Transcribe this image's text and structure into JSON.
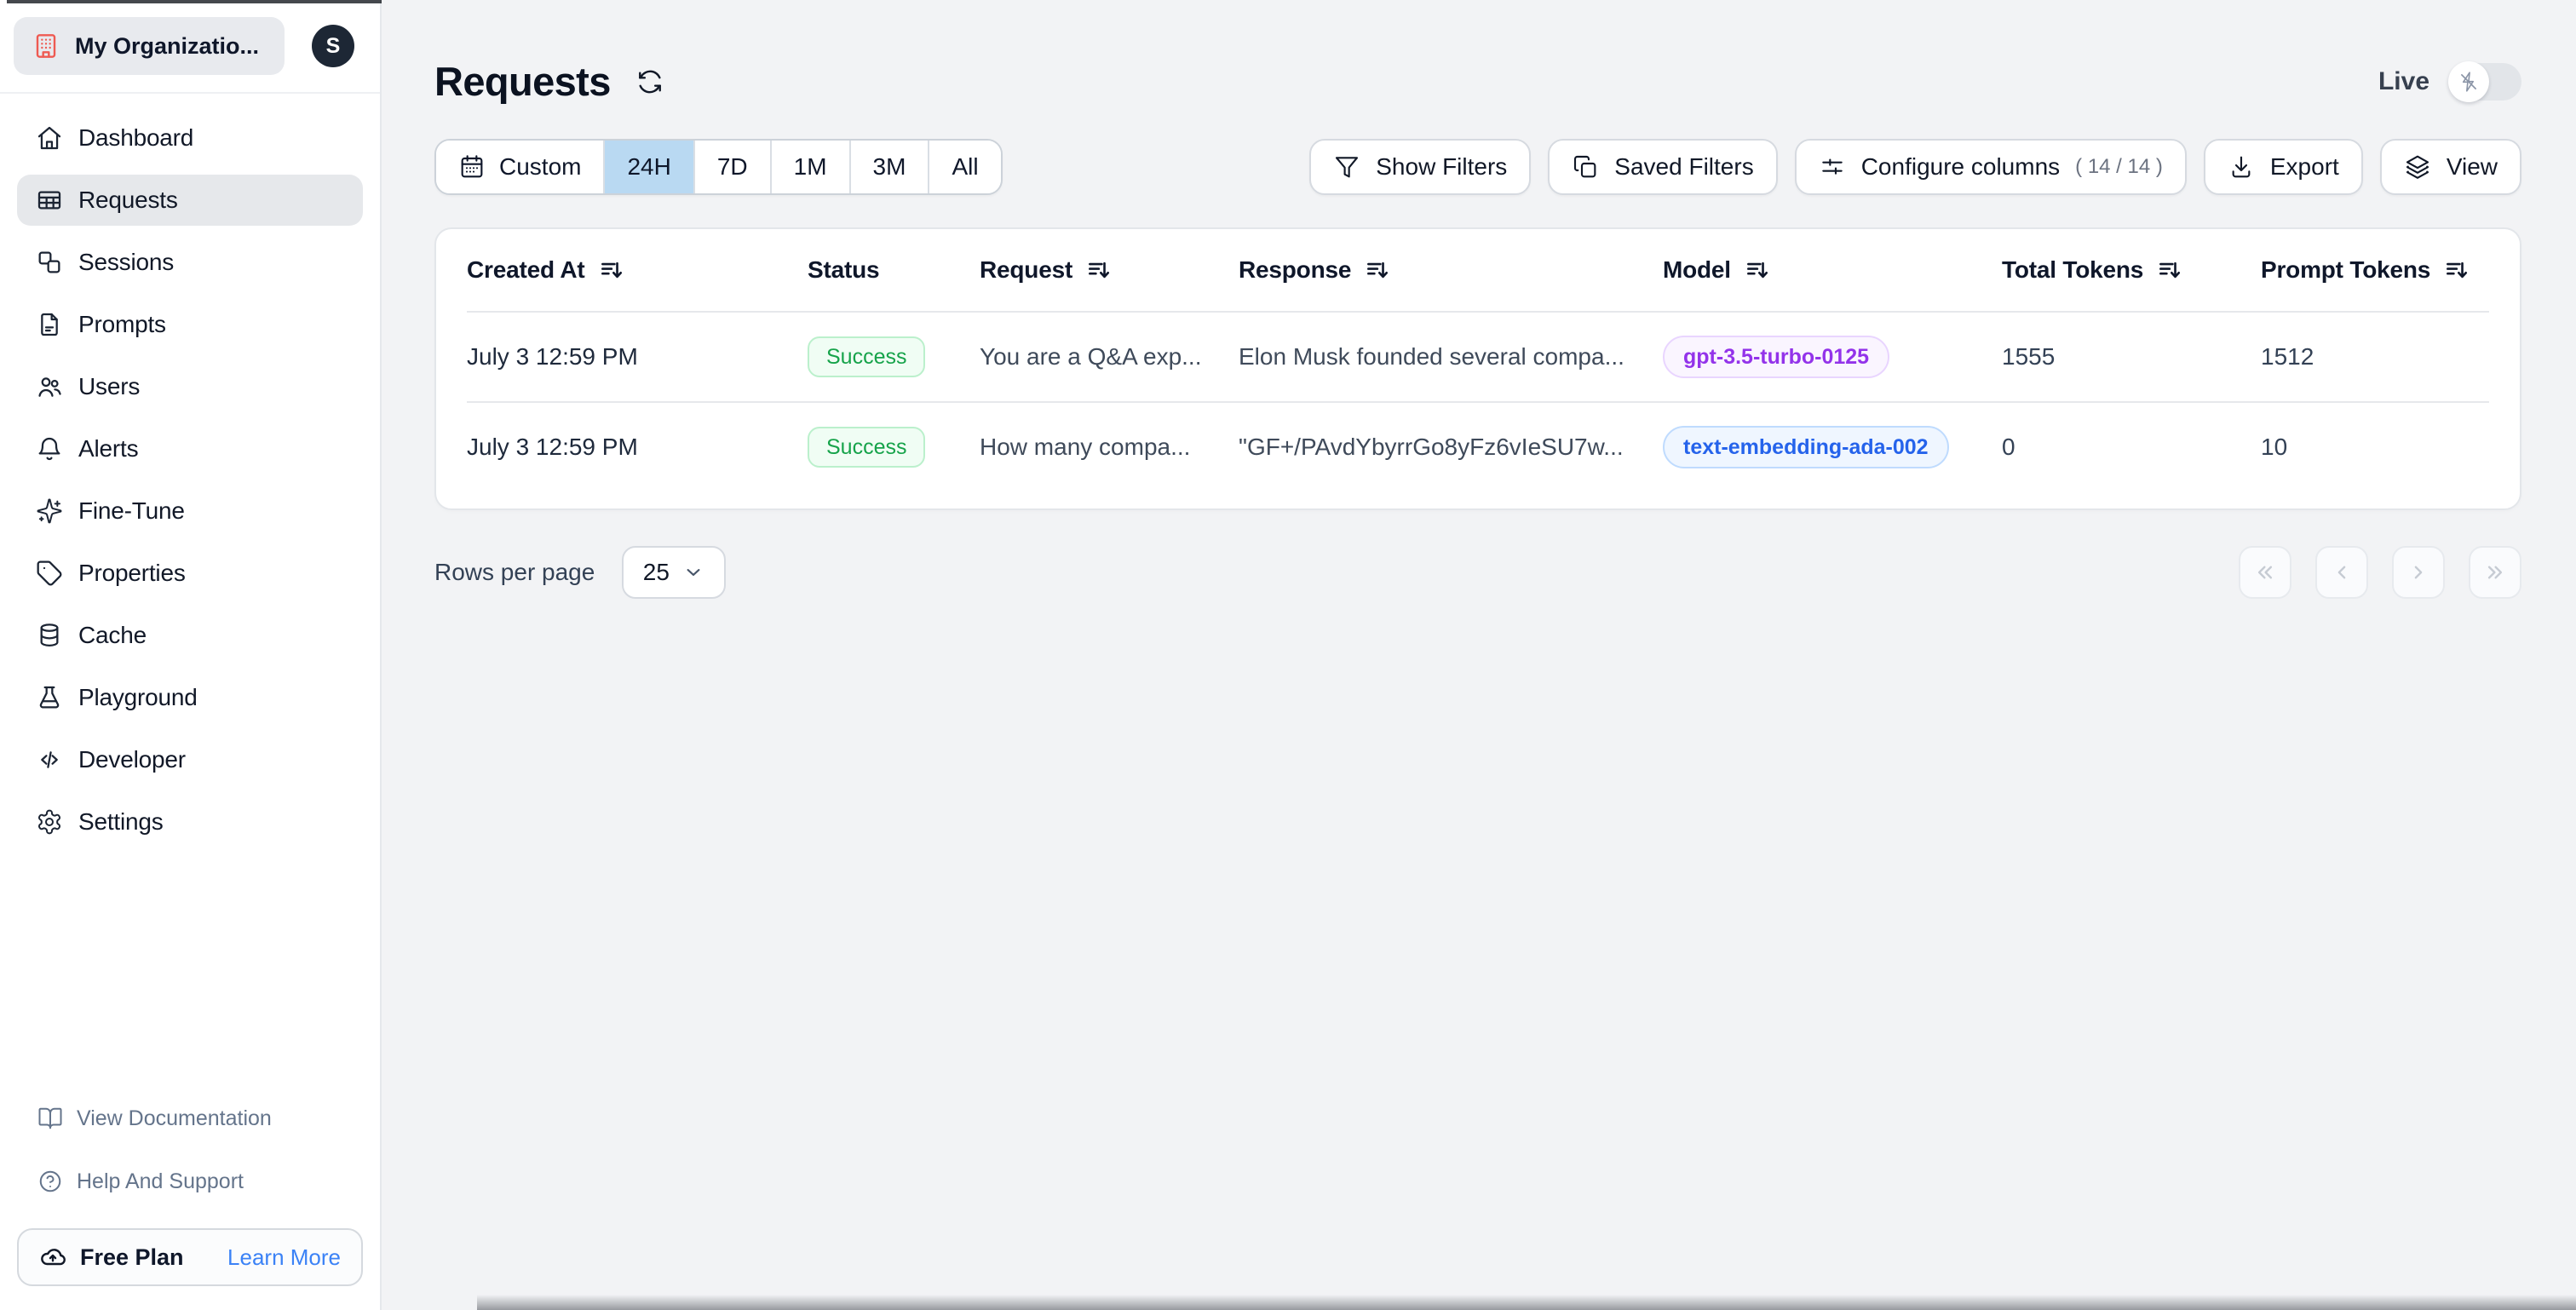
{
  "colors": {
    "page-bg": "#f2f3f5",
    "sidebar-bg": "#ffffff",
    "brand-red": "#ee5a52",
    "avatar-bg": "#1d2735",
    "selected-nav-bg": "#e6e8eb",
    "range-selected-bg": "#b9d9f2",
    "link-blue": "#3b82f6",
    "success-bg": "#f0fdf4",
    "success-border": "#bbf0cc",
    "success-text": "#16a34a",
    "purple-bg": "#faf5ff",
    "purple-border": "#e9d5ff",
    "purple-text": "#9333ea",
    "blue-bg": "#eff6ff",
    "blue-border": "#bfdbfe",
    "blue-text": "#2563eb"
  },
  "sidebar": {
    "org_name": "My Organizatio...",
    "avatar_initial": "S",
    "items": [
      {
        "label": "Dashboard",
        "icon": "home-icon"
      },
      {
        "label": "Requests",
        "icon": "table-icon",
        "active": true
      },
      {
        "label": "Sessions",
        "icon": "sessions-squares-icon"
      },
      {
        "label": "Prompts",
        "icon": "document-icon"
      },
      {
        "label": "Users",
        "icon": "users-icon"
      },
      {
        "label": "Alerts",
        "icon": "bell-icon"
      },
      {
        "label": "Fine-Tune",
        "icon": "sparkles-icon"
      },
      {
        "label": "Properties",
        "icon": "tag-icon"
      },
      {
        "label": "Cache",
        "icon": "database-icon"
      },
      {
        "label": "Playground",
        "icon": "flask-icon"
      },
      {
        "label": "Developer",
        "icon": "code-icon"
      },
      {
        "label": "Settings",
        "icon": "gear-icon"
      }
    ],
    "footer": {
      "docs": "View Documentation",
      "help": "Help And Support",
      "plan": "Free Plan",
      "plan_link": "Learn More"
    }
  },
  "header": {
    "title": "Requests",
    "live_label": "Live"
  },
  "time_ranges": {
    "custom_label": "Custom",
    "options": [
      "24H",
      "7D",
      "1M",
      "3M",
      "All"
    ],
    "selected": "24H"
  },
  "toolbar": {
    "show_filters": "Show Filters",
    "saved_filters": "Saved Filters",
    "configure_columns": "Configure columns",
    "configure_count": "( 14 / 14 )",
    "export": "Export",
    "view": "View"
  },
  "table": {
    "columns": [
      {
        "label": "Created At",
        "sortable": true
      },
      {
        "label": "Status",
        "sortable": false
      },
      {
        "label": "Request",
        "sortable": true
      },
      {
        "label": "Response",
        "sortable": true
      },
      {
        "label": "Model",
        "sortable": true
      },
      {
        "label": "Total Tokens",
        "sortable": true
      },
      {
        "label": "Prompt Tokens",
        "sortable": true
      }
    ],
    "rows": [
      {
        "created_at": "July 3 12:59 PM",
        "status": "Success",
        "request": "You are a Q&A exp...",
        "response": "Elon Musk founded several compa...",
        "model": "gpt-3.5-turbo-0125",
        "model_color": "purple",
        "total_tokens": "1555",
        "prompt_tokens": "1512"
      },
      {
        "created_at": "July 3 12:59 PM",
        "status": "Success",
        "request": "How many compa...",
        "response": "\"GF+/PAvdYbyrrGo8yFz6vIeSU7w...",
        "model": "text-embedding-ada-002",
        "model_color": "blue",
        "total_tokens": "0",
        "prompt_tokens": "10"
      }
    ]
  },
  "pagination": {
    "rows_per_page_label": "Rows per page",
    "rows_per_page_value": "25"
  },
  "icons": {
    "org": "building-icon",
    "refresh": "refresh-icon",
    "live_toggle": "zap-off-icon",
    "custom_range": "calendar-icon",
    "show_filters": "funnel-icon",
    "saved_filters": "copy-icon",
    "configure_columns": "sliders-icon",
    "export": "download-icon",
    "view": "layers-icon",
    "sort": "sort-arrow-icon",
    "rows_select": "chevron-down-icon",
    "pager": [
      "chevrons-left-icon",
      "chevron-left-icon",
      "chevron-right-icon",
      "chevrons-right-icon"
    ],
    "docs": "book-open-icon",
    "help": "help-circle-icon",
    "plan": "cloud-upload-icon"
  }
}
